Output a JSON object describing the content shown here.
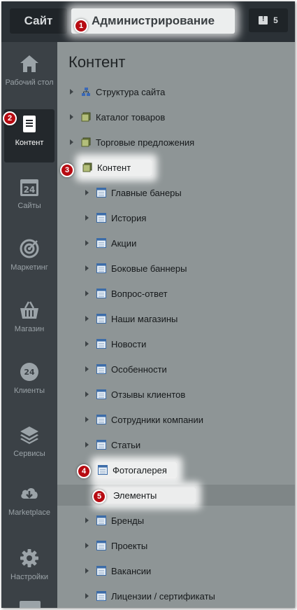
{
  "topbar": {
    "site_label": "Сайт",
    "admin_label": "Администрирование",
    "notifications_count": "5"
  },
  "sidebar": {
    "items": [
      {
        "label": "Рабочий стол",
        "icon": "home-icon"
      },
      {
        "label": "Контент",
        "icon": "document-icon",
        "active": true
      },
      {
        "label": "Сайты",
        "icon": "calendar-24-icon"
      },
      {
        "label": "Маркетинг",
        "icon": "target-icon"
      },
      {
        "label": "Магазин",
        "icon": "basket-icon"
      },
      {
        "label": "Клиенты",
        "icon": "clients-24-icon"
      },
      {
        "label": "Сервисы",
        "icon": "layers-icon"
      },
      {
        "label": "Marketplace",
        "icon": "cloud-download-icon"
      },
      {
        "label": "Настройки",
        "icon": "gear-icon"
      }
    ]
  },
  "main": {
    "title": "Контент",
    "tree": [
      {
        "label": "Структура сайта",
        "icon": "site-structure-icon",
        "level": 0
      },
      {
        "label": "Каталог товаров",
        "icon": "infoblock-type-icon",
        "level": 0
      },
      {
        "label": "Торговые предложения",
        "icon": "infoblock-type-icon",
        "level": 0
      },
      {
        "label": "Контент",
        "icon": "infoblock-type-icon",
        "level": 0,
        "open": true
      },
      {
        "label": "Главные банеры",
        "icon": "infoblock-icon",
        "level": 1
      },
      {
        "label": "История",
        "icon": "infoblock-icon",
        "level": 1
      },
      {
        "label": "Акции",
        "icon": "infoblock-icon",
        "level": 1
      },
      {
        "label": "Боковые баннеры",
        "icon": "infoblock-icon",
        "level": 1
      },
      {
        "label": "Вопрос-ответ",
        "icon": "infoblock-icon",
        "level": 1
      },
      {
        "label": "Наши магазины",
        "icon": "infoblock-icon",
        "level": 1
      },
      {
        "label": "Новости",
        "icon": "infoblock-icon",
        "level": 1
      },
      {
        "label": "Особенности",
        "icon": "infoblock-icon",
        "level": 1
      },
      {
        "label": "Отзывы клиентов",
        "icon": "infoblock-icon",
        "level": 1
      },
      {
        "label": "Сотрудники компании",
        "icon": "infoblock-icon",
        "level": 1
      },
      {
        "label": "Статьи",
        "icon": "infoblock-icon",
        "level": 1
      },
      {
        "label": "Фотогалерея",
        "icon": "infoblock-icon",
        "level": 1,
        "open": true
      },
      {
        "label": "Элементы",
        "icon": "",
        "level": 2,
        "selected": true
      },
      {
        "label": "Бренды",
        "icon": "infoblock-icon",
        "level": 1
      },
      {
        "label": "Проекты",
        "icon": "infoblock-icon",
        "level": 1
      },
      {
        "label": "Вакансии",
        "icon": "infoblock-icon",
        "level": 1
      },
      {
        "label": "Лицензии / сертификаты",
        "icon": "infoblock-icon",
        "level": 1
      }
    ]
  },
  "badges": [
    "1",
    "2",
    "3",
    "4",
    "5"
  ],
  "colors": {
    "badge": "#b70b12",
    "sidebar": "#3b4146",
    "sidebar_active": "#23282c",
    "main_bg": "#8e9596",
    "topbar": "#2b3136"
  }
}
